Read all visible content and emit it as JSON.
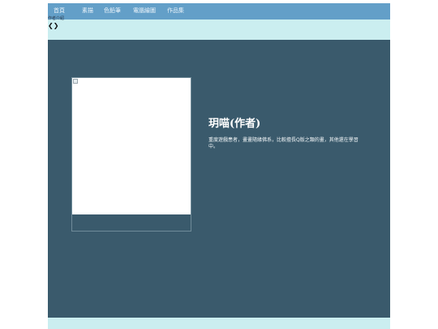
{
  "nav": {
    "items": [
      {
        "label": "首頁"
      },
      {
        "label": "素描"
      },
      {
        "label": "色鉛筆"
      },
      {
        "label": "電腦繪圖"
      },
      {
        "label": "作品集"
      }
    ]
  },
  "breadcrumb": "作者介紹",
  "carousel": {
    "prev_icon": "chevron-left-icon",
    "next_icon": "chevron-right-icon",
    "prev_glyph": "❮",
    "next_glyph": "❯"
  },
  "author": {
    "name": "玥喵(作者)",
    "description": "重度遊戲患者，畫畫隨緣佛系，比較擅長Q版之類的畫，其他還在學習中。"
  },
  "colors": {
    "navbar": "#639fc8",
    "page_bg": "#cbeef0",
    "main_panel": "#3a5a6c"
  }
}
